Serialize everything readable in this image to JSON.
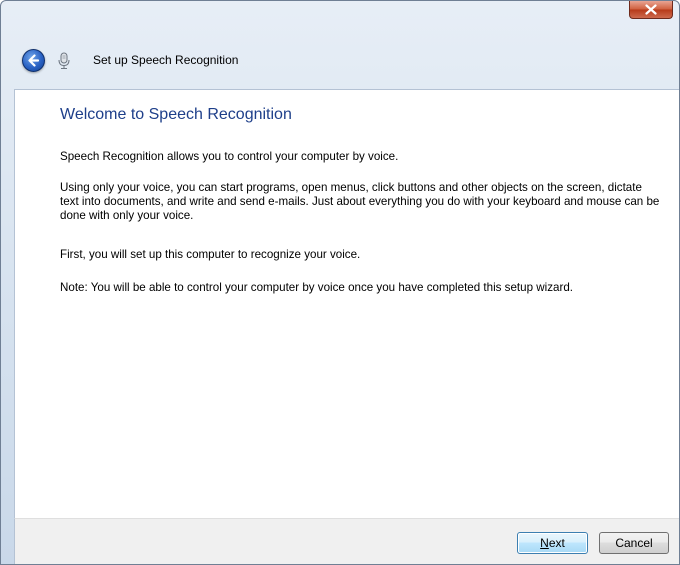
{
  "window": {
    "close_symbol": "x"
  },
  "nav": {
    "back_icon": "back-arrow-icon",
    "app_icon": "microphone-icon",
    "title": "Set up Speech Recognition"
  },
  "content": {
    "heading": "Welcome to Speech Recognition",
    "paragraphs": [
      "Speech Recognition allows you to control your computer by voice.",
      "Using only your voice, you can start programs, open menus, click buttons and other objects on the screen, dictate text into documents, and write and send e-mails. Just about everything you do with your keyboard and mouse can be done with only your voice.",
      "First, you will set up this computer to recognize your voice.",
      "Note: You will be able to control your computer by voice once you have completed this setup wizard."
    ]
  },
  "buttons": {
    "next_label_underlined": "N",
    "next_label_rest": "ext",
    "cancel_label": "Cancel"
  },
  "colors": {
    "heading": "#1e3f8a",
    "next_button_border": "#3c7fb1",
    "close_button": "#c9502e"
  }
}
